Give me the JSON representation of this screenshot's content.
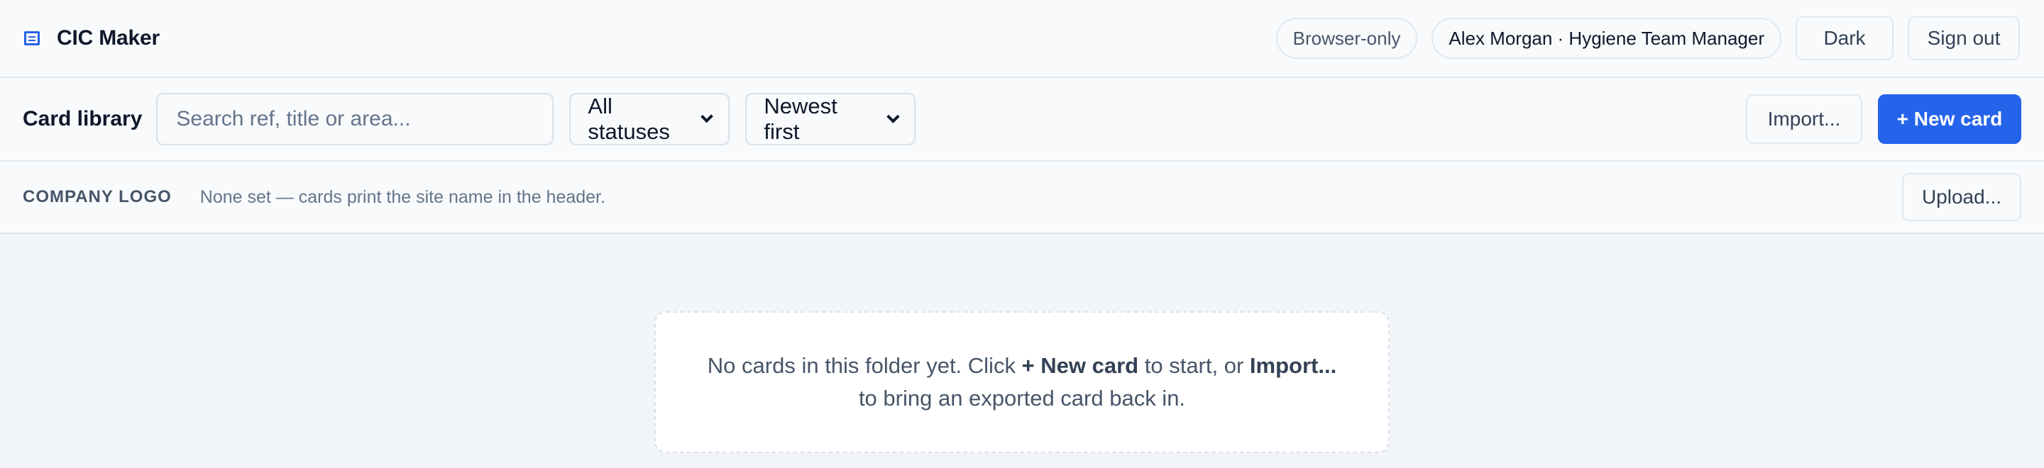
{
  "app": {
    "title": "CIC Maker",
    "mode_badge": "Browser-only",
    "user": "Alex Morgan · Hygiene Team Manager",
    "theme_button": "Dark",
    "signout_button": "Sign out"
  },
  "library": {
    "title": "Card library",
    "search_placeholder": "Search ref, title or area...",
    "status_filter": "All statuses",
    "sort": "Newest first",
    "import_button": "Import...",
    "new_card_button": "+ New card"
  },
  "logo": {
    "label": "COMPANY LOGO",
    "note": "None set — cards print the site name in the header.",
    "upload_button": "Upload..."
  },
  "empty_state": {
    "lead": "No cards in this folder yet. Click ",
    "new_card": "+ New card",
    "middle": " to start, or ",
    "import": "Import...",
    "tail": " to bring an exported card back in."
  },
  "colors": {
    "accent": "#2563eb",
    "page_bg": "#f1f4f8",
    "bar_bg": "#f8fafc"
  },
  "icons": {
    "brand": "card-list-icon",
    "select_chevron": "chevron-down-icon"
  }
}
